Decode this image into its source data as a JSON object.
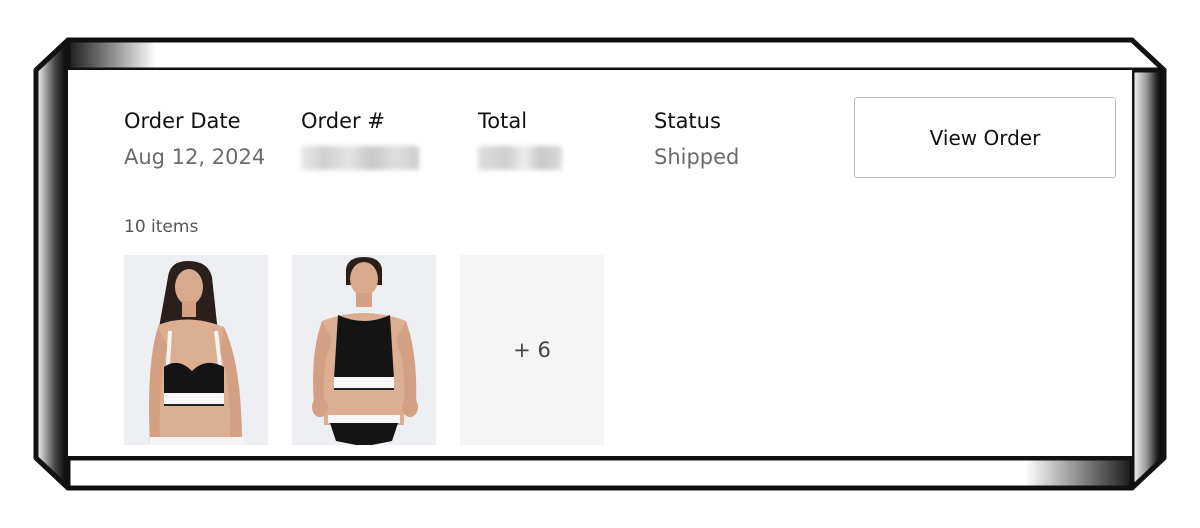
{
  "order": {
    "date_label": "Order Date",
    "date_value": "Aug 12, 2024",
    "number_label": "Order #",
    "total_label": "Total",
    "status_label": "Status",
    "status_value": "Shipped"
  },
  "actions": {
    "view_order_label": "View Order"
  },
  "items": {
    "count_label": "10 items",
    "more_label": "+ 6",
    "thumbnails": [
      {
        "icon": "product-photo-bralette"
      },
      {
        "icon": "product-photo-racerback-bra"
      }
    ]
  },
  "colors": {
    "frame": "#111111",
    "text_primary": "#111111",
    "text_secondary": "#6b6b6b",
    "button_border": "#bdbdbd",
    "thumb_bg": "#f0f0f2"
  }
}
